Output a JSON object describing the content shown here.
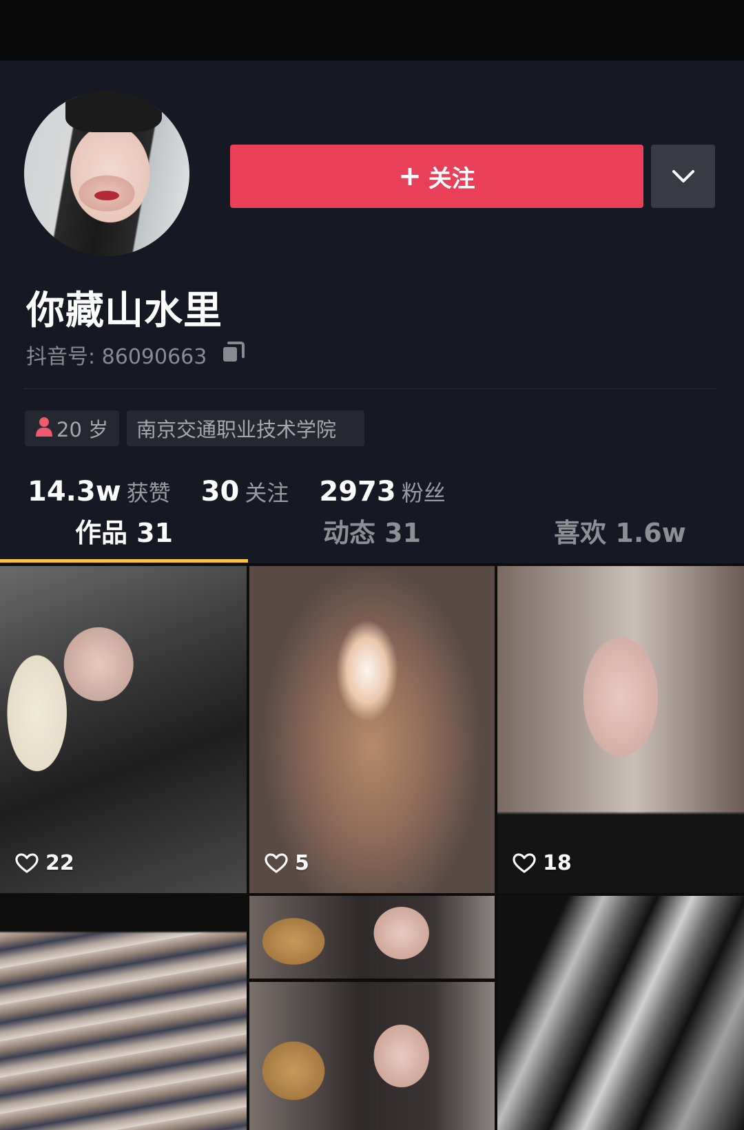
{
  "header": {
    "follow_label": "关注",
    "follow_plus": "+",
    "more_icon": "chevron-down-icon"
  },
  "profile": {
    "nickname": "你藏山水里",
    "douyin_id_label": "抖音号: 86090663",
    "tags": {
      "age": "20 岁",
      "school": "南京交通职业技术学院"
    },
    "stats": [
      {
        "num": "14.3w",
        "label": "获赞"
      },
      {
        "num": "30",
        "label": "关注"
      },
      {
        "num": "2973",
        "label": "粉丝"
      }
    ]
  },
  "tabs": [
    {
      "label": "作品 31"
    },
    {
      "label": "动态 31"
    },
    {
      "label": "喜欢 1.6w"
    }
  ],
  "videos": [
    {
      "likes": "22"
    },
    {
      "likes": "5"
    },
    {
      "likes": "18"
    }
  ],
  "colors": {
    "accent": "#ea3f58",
    "tab_indicator": "#f6c343",
    "background": "#161823"
  }
}
